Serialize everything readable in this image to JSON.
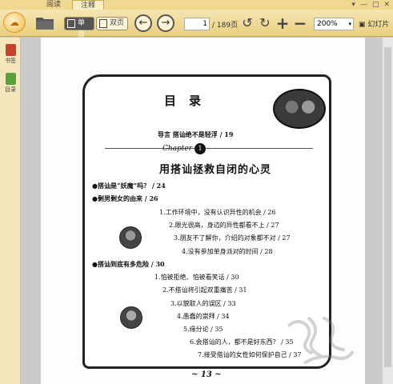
{
  "tabs": [
    {
      "label": "阅读"
    },
    {
      "label": "注释"
    }
  ],
  "window_controls": [
    "▾",
    "—",
    "□",
    "✕"
  ],
  "toolbar": {
    "single_page_label": "单页",
    "double_page_label": "双页",
    "current_page": "1",
    "total_pages": "/ 189页",
    "zoom": "200%",
    "zoom_arrow": "▾",
    "slideshow_label": "幻灯片"
  },
  "sidebar": {
    "items": [
      {
        "label": "书签"
      },
      {
        "label": "目录"
      }
    ]
  },
  "book": {
    "heading": "目录",
    "preface": "导言   搭讪绝不是轻浮 / 19",
    "chapter_word": "Chapter",
    "chapter_number": "1",
    "chapter_title": "用搭讪拯救自闭的心灵",
    "entries": [
      {
        "kind": "sec",
        "text": "●搭讪是“妖魔”吗？ / 24"
      },
      {
        "kind": "sec",
        "text": "●剩男剩女的由来 / 26"
      },
      {
        "kind": "item",
        "text": "1.工作环境中，没有认识异性的机会 / 26"
      },
      {
        "kind": "item",
        "text": "2.眼光很高，身边的异性都看不上 / 27"
      },
      {
        "kind": "item",
        "text": "3.朋友不了解你，介绍的对象都不对 / 27"
      },
      {
        "kind": "item",
        "text": "4.没有参加单身派对的时间 / 28"
      },
      {
        "kind": "sec",
        "text": "●搭讪到底有多危险 / 30"
      },
      {
        "kind": "item",
        "text": "1.怕被拒绝、怕被看笑话 / 30"
      },
      {
        "kind": "item",
        "text": "2.不搭讪将引起双重痛苦 / 31"
      },
      {
        "kind": "item",
        "text": "3.以貌取人的误区 / 33"
      },
      {
        "kind": "item",
        "text": "4.愚蠢的崇拜 / 34"
      },
      {
        "kind": "item",
        "text": "5.缘分论 / 35"
      },
      {
        "kind": "item",
        "text": "6.会搭讪的人，都不是好东西？ / 35"
      },
      {
        "kind": "item",
        "text": "7.接受搭讪的女性如何保护自己 / 37"
      }
    ],
    "page_number": "13"
  }
}
